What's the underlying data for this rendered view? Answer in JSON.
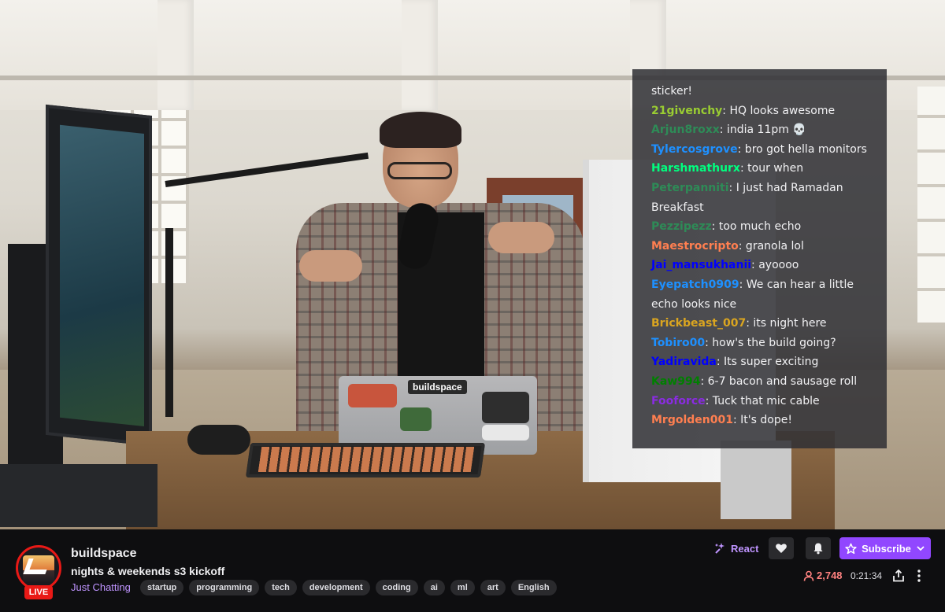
{
  "video": {
    "laptop_label": "buildspace"
  },
  "chat": {
    "lines": [
      {
        "user": "",
        "color": "#f1f1f3",
        "message": "sticker!"
      },
      {
        "user": "21givenchy",
        "color": "#9acd32",
        "message": ": HQ looks awesome"
      },
      {
        "user": "Arjun8roxx",
        "color": "#2e8b57",
        "message": ": india 11pm 💀"
      },
      {
        "user": "Tylercosgrove",
        "color": "#1e90ff",
        "message": ": bro got hella monitors"
      },
      {
        "user": "Harshmathurx",
        "color": "#00ff7f",
        "message": ": tour when"
      },
      {
        "user": "Peterpanniti",
        "color": "#2e8b57",
        "message": ": I just had Ramadan Breakfast"
      },
      {
        "user": "Pezzipezz",
        "color": "#2e8b57",
        "message": ": too much echo"
      },
      {
        "user": "Maestrocripto",
        "color": "#ff7f50",
        "message": ": granola lol"
      },
      {
        "user": "Jai_mansukhanii",
        "color": "#0000ff",
        "message": ": ayoooo"
      },
      {
        "user": "Eyepatch0909",
        "color": "#1e90ff",
        "message": ": We can hear a little echo looks nice"
      },
      {
        "user": "Brickbeast_007",
        "color": "#daa520",
        "message": ": its night here"
      },
      {
        "user": "Tobiro00",
        "color": "#1e90ff",
        "message": ": how's the build going?"
      },
      {
        "user": "Yadiravida",
        "color": "#0000ff",
        "message": ": Its super exciting"
      },
      {
        "user": "Kaw994",
        "color": "#008000",
        "message": ": 6-7 bacon and sausage roll"
      },
      {
        "user": "Fooforce",
        "color": "#8a2be2",
        "message": ": Tuck that mic cable"
      },
      {
        "user": "Mrgolden001",
        "color": "#ff7f50",
        "message": ": It's dope!"
      }
    ]
  },
  "channel": {
    "name": "buildspace",
    "title": "nights & weekends s3 kickoff",
    "category": "Just Chatting",
    "live_label": "LIVE",
    "tags": [
      "startup",
      "programming",
      "tech",
      "development",
      "coding",
      "ai",
      "ml",
      "art",
      "English"
    ]
  },
  "actions": {
    "react_label": "React",
    "subscribe_label": "Subscribe",
    "viewer_count": "2,748",
    "uptime": "0:21:34"
  },
  "colors": {
    "accent": "#9147ff",
    "accent_text": "#bf94ff",
    "live": "#e91916",
    "viewers": "#ff8280"
  },
  "icons": {
    "react": "react-sparkle-icon",
    "follow": "heart-icon",
    "notifications": "bell-icon",
    "subscribe": "star-icon",
    "subscribe_menu": "chevron-down-icon",
    "viewers": "person-icon",
    "share": "share-icon",
    "more": "more-vertical-icon"
  }
}
